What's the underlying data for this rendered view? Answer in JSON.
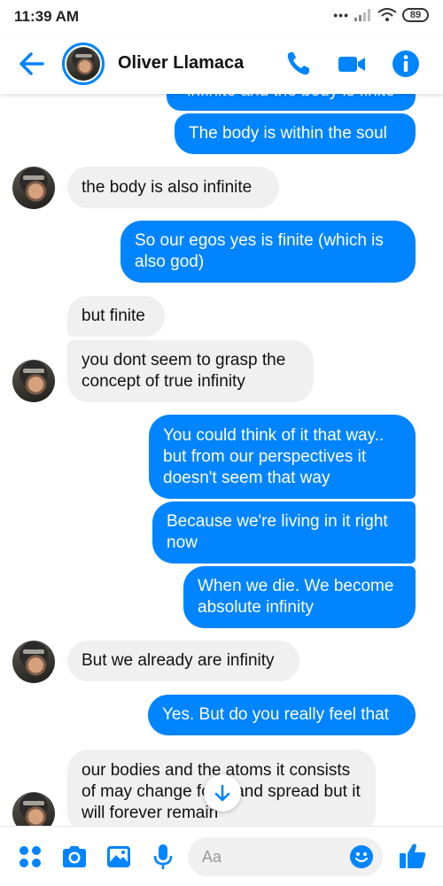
{
  "status": {
    "time": "11:39 AM",
    "battery": "89"
  },
  "header": {
    "contact_name": "Oliver Llamaca"
  },
  "messages": [
    {
      "text": "infinite and the body is finite"
    },
    {
      "text": "The body is within the soul"
    },
    {
      "text": "the body is also infinite"
    },
    {
      "text": "So our egos yes is finite (which is also god)"
    },
    {
      "text": "but finite"
    },
    {
      "text": "you dont seem to grasp the concept of true infinity"
    },
    {
      "text": "You could think of it that way.. but from our perspectives it doesn't seem that way"
    },
    {
      "text": "Because we're living in it right now"
    },
    {
      "text": "When we die. We become absolute infinity"
    },
    {
      "text": "But we already are infinity"
    },
    {
      "text": "Yes. But do you really feel that"
    },
    {
      "text": "our bodies and the atoms it consists of may change form and spread but it will forever remain"
    }
  ],
  "composer": {
    "placeholder": "Aa"
  },
  "colors": {
    "accent": "#0084ff",
    "incoming_bubble": "#f0f0f0"
  },
  "icons": [
    "back-arrow-icon",
    "phone-icon",
    "video-camera-icon",
    "info-icon",
    "menu-grid-icon",
    "camera-icon",
    "image-icon",
    "microphone-icon",
    "emoji-icon",
    "thumbs-up-icon",
    "arrow-down-icon"
  ]
}
